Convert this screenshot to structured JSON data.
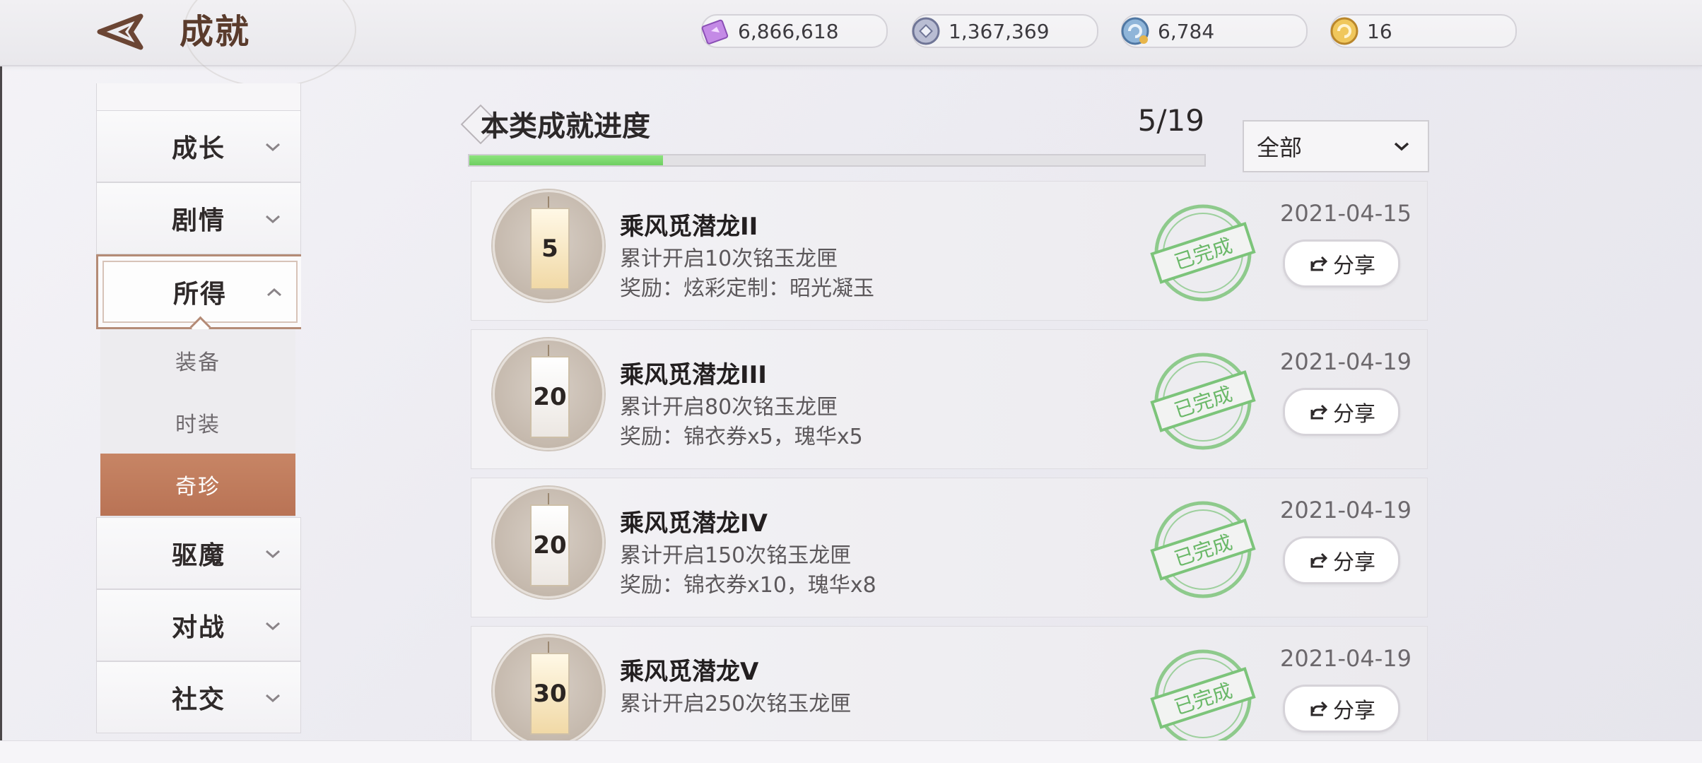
{
  "header": {
    "title": "成就",
    "currencies": [
      {
        "icon": "crystal-card-icon",
        "value": "6,866,618"
      },
      {
        "icon": "silver-coin-icon",
        "value": "1,367,369"
      },
      {
        "icon": "blue-token-icon",
        "value": "6,784"
      },
      {
        "icon": "gold-token-icon",
        "value": "16"
      }
    ]
  },
  "sidebar": {
    "items": [
      {
        "label": "成长"
      },
      {
        "label": "剧情"
      },
      {
        "label": "所得",
        "expanded": true
      },
      {
        "label": "驱魔"
      },
      {
        "label": "对战"
      },
      {
        "label": "社交"
      }
    ],
    "sub_items": [
      {
        "label": "装备"
      },
      {
        "label": "时装"
      },
      {
        "label": "奇珍",
        "selected": true
      }
    ]
  },
  "progress": {
    "title": "本类成就进度",
    "count": "5/19",
    "fraction": 0.263
  },
  "filter": {
    "label": "全部"
  },
  "achievements": [
    {
      "badge": "5",
      "tag_style": "gold",
      "name": "乘风觅潜龙II",
      "desc": "累计开启10次铭玉龙匣",
      "reward": "奖励：炫彩定制：昭光凝玉",
      "stamp": "已完成",
      "date": "2021-04-15",
      "share": "分享"
    },
    {
      "badge": "20",
      "tag_style": "white",
      "name": "乘风觅潜龙III",
      "desc": "累计开启80次铭玉龙匣",
      "reward": "奖励：锦衣券x5，瑰华x5",
      "stamp": "已完成",
      "date": "2021-04-19",
      "share": "分享"
    },
    {
      "badge": "20",
      "tag_style": "white",
      "name": "乘风觅潜龙IV",
      "desc": "累计开启150次铭玉龙匣",
      "reward": "奖励：锦衣券x10，瑰华x8",
      "stamp": "已完成",
      "date": "2021-04-19",
      "share": "分享"
    },
    {
      "badge": "30",
      "tag_style": "gold",
      "name": "乘风觅潜龙V",
      "desc": "累计开启250次铭玉龙匣",
      "reward": "",
      "stamp": "已完成",
      "date": "2021-04-19",
      "share": "分享"
    }
  ]
}
